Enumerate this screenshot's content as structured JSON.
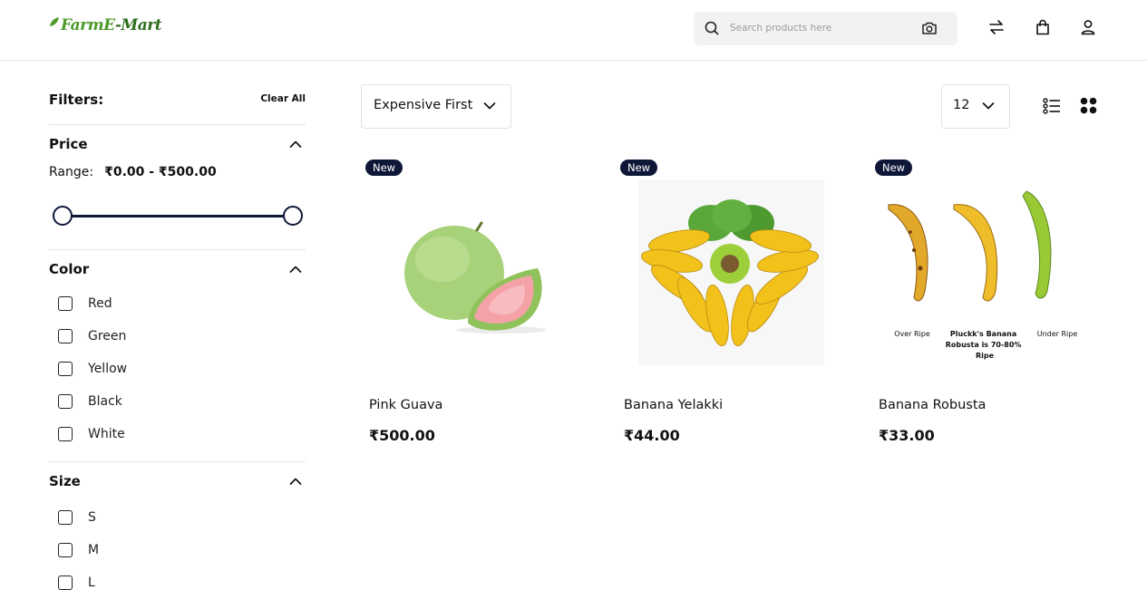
{
  "header": {
    "logo_text": "FarmE-Mart",
    "search_placeholder": "Search products here"
  },
  "filters": {
    "title": "Filters:",
    "clear_label": "Clear All",
    "price": {
      "title": "Price",
      "range_label": "Range:",
      "range_value": "₹0.00 - ₹500.00",
      "min": 0,
      "max": 500,
      "selected_min": 0,
      "selected_max": 500
    },
    "color": {
      "title": "Color",
      "options": [
        "Red",
        "Green",
        "Yellow",
        "Black",
        "White"
      ]
    },
    "size": {
      "title": "Size",
      "options": [
        "S",
        "M",
        "L"
      ]
    }
  },
  "toolbar": {
    "sort_value": "Expensive First",
    "per_page_value": "12"
  },
  "products": [
    {
      "badge": "New",
      "name": "Pink Guava",
      "price": "₹500.00"
    },
    {
      "badge": "New",
      "name": "Banana Yelakki",
      "price": "₹44.00"
    },
    {
      "badge": "New",
      "name": "Banana Robusta",
      "price": "₹33.00",
      "image_labels": [
        "Over Ripe",
        "Pluckk's Banana Robusta is 70-80% Ripe",
        "Under Ripe"
      ]
    }
  ],
  "colors": {
    "accent": "#0f1738",
    "logo_green": "#4d9a2a"
  }
}
